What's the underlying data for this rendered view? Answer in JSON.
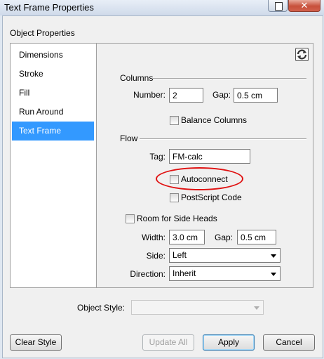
{
  "window": {
    "title": "Text Frame Properties",
    "close_glyph": "✕"
  },
  "section_title": "Object Properties",
  "sidebar": {
    "items": [
      {
        "label": "Dimensions"
      },
      {
        "label": "Stroke"
      },
      {
        "label": "Fill"
      },
      {
        "label": "Run Around"
      },
      {
        "label": "Text Frame"
      }
    ],
    "selected_index": 4
  },
  "columns": {
    "header": "Columns",
    "number_label": "Number:",
    "number_value": "2",
    "gap_label": "Gap:",
    "gap_value": "0.5 cm",
    "balance_label": "Balance Columns",
    "balance_checked": false
  },
  "flow": {
    "header": "Flow",
    "tag_label": "Tag:",
    "tag_value": "FM-calc",
    "autoconnect_label": "Autoconnect",
    "autoconnect_checked": false,
    "postscript_label": "PostScript Code",
    "postscript_checked": false
  },
  "side_heads": {
    "room_label": "Room for Side Heads",
    "room_checked": false,
    "width_label": "Width:",
    "width_value": "3.0 cm",
    "gap_label": "Gap:",
    "gap_value": "0.5 cm",
    "side_label": "Side:",
    "side_value": "Left",
    "direction_label": "Direction:",
    "direction_value": "Inherit"
  },
  "object_style": {
    "label": "Object Style:",
    "value": ""
  },
  "buttons": {
    "clear_style": "Clear Style",
    "update_all": "Update All",
    "apply": "Apply",
    "cancel": "Cancel"
  },
  "colors": {
    "selection": "#3399ff",
    "highlight": "#e01212"
  }
}
